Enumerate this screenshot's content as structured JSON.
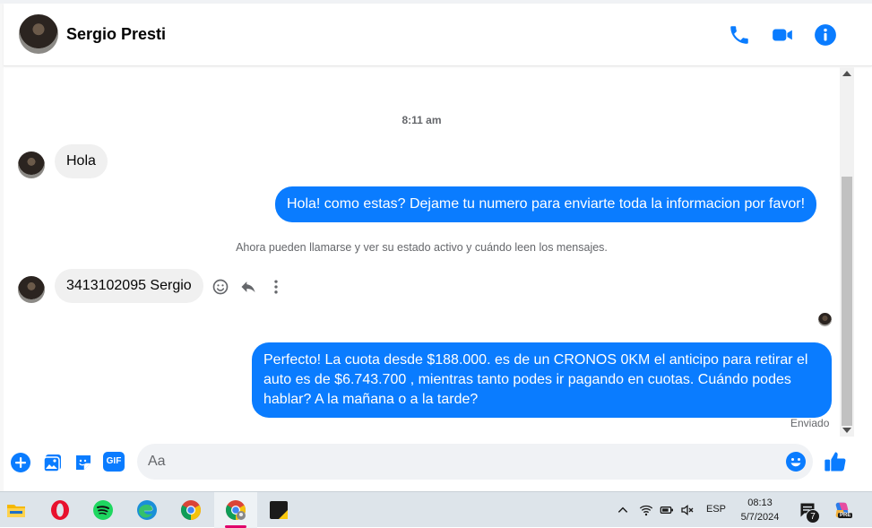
{
  "header": {
    "contact_name": "Sergio Presti",
    "icons": [
      "phone-icon",
      "video-camera-icon",
      "info-icon"
    ]
  },
  "chat": {
    "timestamp": "8:11 am",
    "system_message": "Ahora pueden llamarse y ver su estado activo y cuándo leen los mensajes.",
    "messages": [
      {
        "direction": "incoming",
        "text": "Hola"
      },
      {
        "direction": "outgoing",
        "text": "Hola! como estas? Dejame tu numero para enviarte toda la informacion por favor!"
      },
      {
        "direction": "incoming",
        "text": "3413102095 Sergio"
      },
      {
        "direction": "outgoing",
        "text": "Perfecto! La cuota desde $188.000. es de un CRONOS 0KM el anticipo para retirar el auto es de $6.743.700 , mientras tanto podes ir pagando en cuotas. Cuándo podes hablar? A la mañana o a la tarde?"
      }
    ],
    "message_actions": [
      "react-icon",
      "reply-icon",
      "more-icon"
    ],
    "sent_status": "Enviado"
  },
  "composer": {
    "placeholder": "Aa",
    "value": "",
    "icons": [
      "plus-icon",
      "image-icon",
      "sticker-icon",
      "gif-icon",
      "emoji-icon",
      "like-icon"
    ],
    "gif_label": "GIF"
  },
  "taskbar": {
    "apps": [
      "file-explorer-icon",
      "opera-icon",
      "spotify-icon",
      "edge-icon",
      "chrome-icon",
      "chrome-profile-icon",
      "sticky-app-icon"
    ],
    "language": "ESP",
    "time": "08:13",
    "date": "5/7/2024",
    "notification_count": "7",
    "copilot_badge": "PRE"
  },
  "colors": {
    "accent": "#0a7cff",
    "incoming_bubble": "#f0f0f0",
    "text_secondary": "#65676b"
  }
}
